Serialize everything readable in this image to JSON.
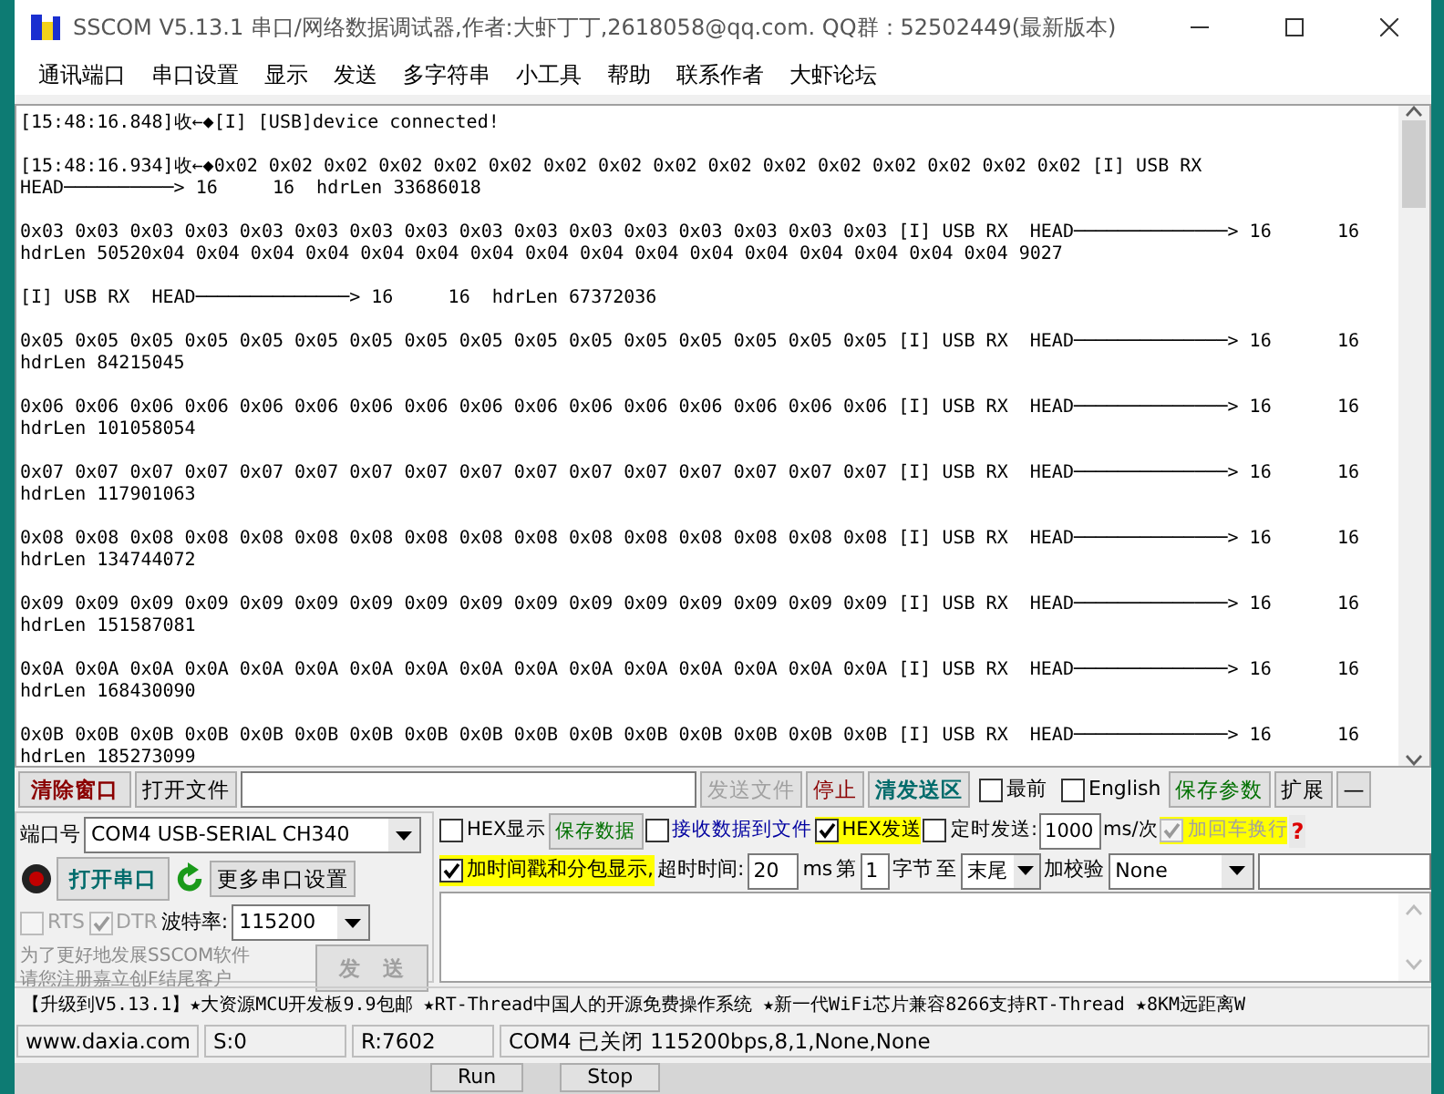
{
  "window": {
    "title": "SSCOM V5.13.1 串口/网络数据调试器,作者:大虾丁丁,2618058@qq.com. QQ群：52502449(最新版本)"
  },
  "menu": [
    "通讯端口",
    "串口设置",
    "显示",
    "发送",
    "多字符串",
    "小工具",
    "帮助",
    "联系作者",
    "大虾论坛"
  ],
  "log": [
    {
      "lines": [
        "[15:48:16.848]收←◆[I] [USB]device connected!"
      ]
    },
    {
      "lines": [
        "[15:48:16.934]收←◆0x02 0x02 0x02 0x02 0x02 0x02 0x02 0x02 0x02 0x02 0x02 0x02 0x02 0x02 0x02 0x02 [I] USB RX",
        "HEAD──────────> 16     16  hdrLen 33686018"
      ]
    },
    {
      "lines": [
        "0x03 0x03 0x03 0x03 0x03 0x03 0x03 0x03 0x03 0x03 0x03 0x03 0x03 0x03 0x03 0x03 [I] USB RX  HEAD──────────────> 16      16",
        "hdrLen 50520x04 0x04 0x04 0x04 0x04 0x04 0x04 0x04 0x04 0x04 0x04 0x04 0x04 0x04 0x04 0x04 9027"
      ]
    },
    {
      "lines": [
        "[I] USB RX  HEAD──────────────> 16     16  hdrLen 67372036"
      ]
    },
    {
      "lines": [
        "0x05 0x05 0x05 0x05 0x05 0x05 0x05 0x05 0x05 0x05 0x05 0x05 0x05 0x05 0x05 0x05 [I] USB RX  HEAD──────────────> 16      16",
        "hdrLen 84215045"
      ]
    },
    {
      "lines": [
        "0x06 0x06 0x06 0x06 0x06 0x06 0x06 0x06 0x06 0x06 0x06 0x06 0x06 0x06 0x06 0x06 [I] USB RX  HEAD──────────────> 16      16",
        "hdrLen 101058054"
      ]
    },
    {
      "lines": [
        "0x07 0x07 0x07 0x07 0x07 0x07 0x07 0x07 0x07 0x07 0x07 0x07 0x07 0x07 0x07 0x07 [I] USB RX  HEAD──────────────> 16      16",
        "hdrLen 117901063"
      ]
    },
    {
      "lines": [
        "0x08 0x08 0x08 0x08 0x08 0x08 0x08 0x08 0x08 0x08 0x08 0x08 0x08 0x08 0x08 0x08 [I] USB RX  HEAD──────────────> 16      16",
        "hdrLen 134744072"
      ]
    },
    {
      "lines": [
        "0x09 0x09 0x09 0x09 0x09 0x09 0x09 0x09 0x09 0x09 0x09 0x09 0x09 0x09 0x09 0x09 [I] USB RX  HEAD──────────────> 16      16",
        "hdrLen 151587081"
      ]
    },
    {
      "lines": [
        "0x0A 0x0A 0x0A 0x0A 0x0A 0x0A 0x0A 0x0A 0x0A 0x0A 0x0A 0x0A 0x0A 0x0A 0x0A 0x0A [I] USB RX  HEAD──────────────> 16      16",
        "hdrLen 168430090"
      ]
    },
    {
      "lines": [
        "0x0B 0x0B 0x0B 0x0B 0x0B 0x0B 0x0B 0x0B 0x0B 0x0B 0x0B 0x0B 0x0B 0x0B 0x0B 0x0B [I] USB RX  HEAD──────────────> 16      16",
        "hdrLen 185273099"
      ]
    }
  ],
  "toolbar": {
    "clear_button": "清除窗口",
    "open_file_button": "打开文件",
    "send_file_button": {
      "label": "发送文件",
      "disabled": true
    },
    "stop_button": "停止",
    "clear_send_button": "清发送区",
    "topmost": {
      "label": "最前",
      "checked": false
    },
    "english": {
      "label": "English",
      "checked": false
    },
    "save_params_button": "保存参数",
    "expand_button": "扩展",
    "collapse_button": "—"
  },
  "port": {
    "label": "端口号",
    "value": "COM4  USB-SERIAL CH340",
    "open_button": "打开串口",
    "more_settings_button": "更多串口设置",
    "rts": {
      "label": "RTS",
      "checked": false,
      "disabled": true
    },
    "dtr": {
      "label": "DTR",
      "checked": true,
      "disabled": true
    },
    "baud_label": "波特率:",
    "baud_value": "115200",
    "promo_lines": [
      "为了更好地发展SSCOM软件",
      "请您注册嘉立创F结尾客户"
    ],
    "send_button": {
      "label": "发　送",
      "disabled": true
    }
  },
  "options": {
    "hex_display": {
      "label": "HEX显示",
      "checked": false
    },
    "save_data_button": "保存数据",
    "receive_to_file": {
      "label": "接收数据到文件",
      "checked": false
    },
    "hex_send": {
      "label": "HEX发送",
      "checked": true
    },
    "timed_send": {
      "label": "定时发送:",
      "checked": false
    },
    "interval": "1000",
    "interval_unit": "ms/次",
    "add_crlf": {
      "label": "加回车换行",
      "checked": true,
      "disabled": true
    },
    "help": "?",
    "timestamp": {
      "label": "加时间戳和分包显示,",
      "checked": true
    },
    "timeout_label": "超时时间:",
    "timeout": "20",
    "timeout_unit": "ms",
    "from_label": "第",
    "from_byte": "1",
    "byte_label": "字节",
    "to_label": "至",
    "to_value": "末尾",
    "checksum_label": "加校验",
    "checksum_value": "None"
  },
  "marquee": "【升级到V5.13.1】★大资源MCU开发板9.9包邮 ★RT-Thread中国人的开源免费操作系统 ★新一代WiFi芯片兼容8266支持RT-Thread ★8KM远距离W",
  "status_bar": [
    "www.daxia.com",
    "S:0",
    "R:7602",
    "COM4 已关闭  115200bps,8,1,None,None"
  ],
  "background_buttons": [
    "Run",
    "Stop"
  ]
}
